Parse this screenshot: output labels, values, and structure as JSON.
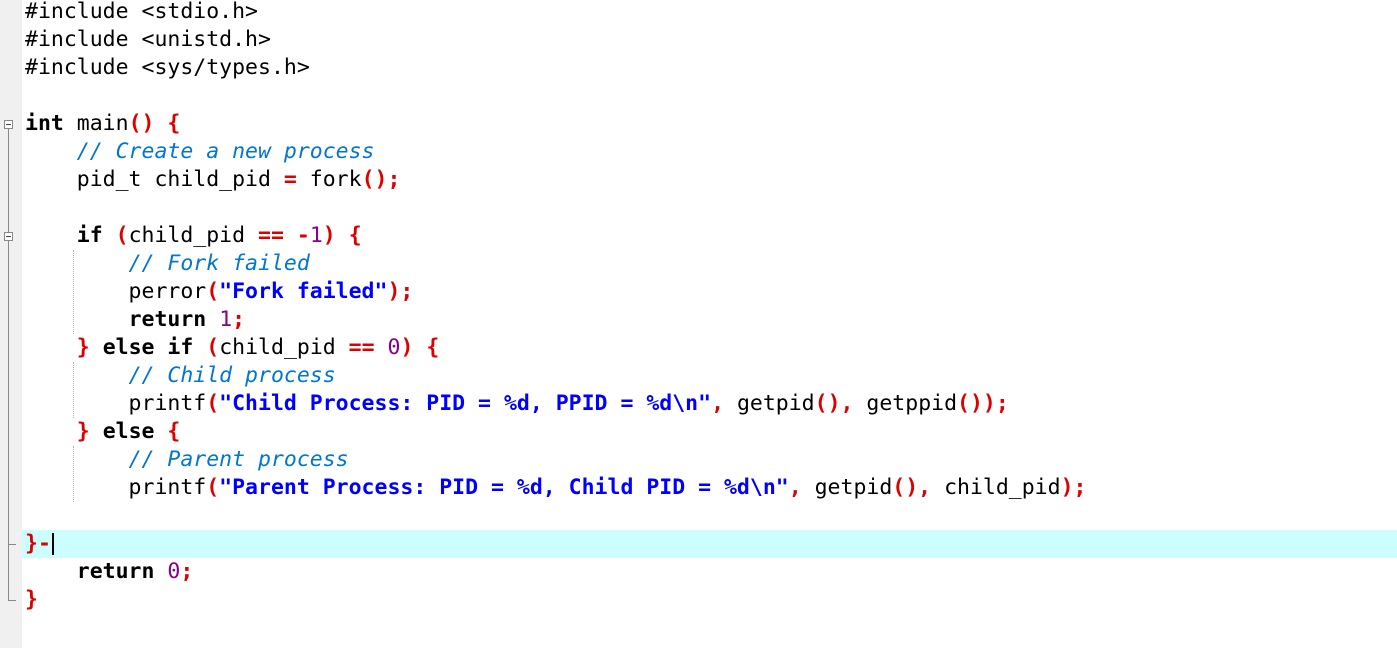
{
  "editor": {
    "lines": [
      [
        {
          "t": "#include <stdio.h>",
          "c": ""
        }
      ],
      [
        {
          "t": "#include <unistd.h>",
          "c": ""
        }
      ],
      [
        {
          "t": "#include <sys/types.h>",
          "c": ""
        }
      ],
      [],
      [
        {
          "t": "int",
          "c": "kw"
        },
        {
          "t": " main",
          "c": ""
        },
        {
          "t": "()",
          "c": "op"
        },
        {
          "t": " ",
          "c": ""
        },
        {
          "t": "{",
          "c": "op"
        }
      ],
      [
        {
          "t": "    ",
          "c": ""
        },
        {
          "t": "// Create a new process",
          "c": "cmt"
        }
      ],
      [
        {
          "t": "    pid_t child_pid ",
          "c": ""
        },
        {
          "t": "=",
          "c": "op"
        },
        {
          "t": " fork",
          "c": ""
        },
        {
          "t": "();",
          "c": "op"
        }
      ],
      [],
      [
        {
          "t": "    ",
          "c": ""
        },
        {
          "t": "if",
          "c": "kw"
        },
        {
          "t": " ",
          "c": ""
        },
        {
          "t": "(",
          "c": "op"
        },
        {
          "t": "child_pid ",
          "c": ""
        },
        {
          "t": "==",
          "c": "op"
        },
        {
          "t": " ",
          "c": ""
        },
        {
          "t": "-",
          "c": "op"
        },
        {
          "t": "1",
          "c": "num"
        },
        {
          "t": ")",
          "c": "op"
        },
        {
          "t": " ",
          "c": ""
        },
        {
          "t": "{",
          "c": "op"
        }
      ],
      [
        {
          "t": "        ",
          "c": ""
        },
        {
          "t": "// Fork failed",
          "c": "cmt"
        }
      ],
      [
        {
          "t": "        perror",
          "c": ""
        },
        {
          "t": "(",
          "c": "op"
        },
        {
          "t": "\"Fork failed\"",
          "c": "str"
        },
        {
          "t": ");",
          "c": "op"
        }
      ],
      [
        {
          "t": "        ",
          "c": ""
        },
        {
          "t": "return",
          "c": "kw"
        },
        {
          "t": " ",
          "c": ""
        },
        {
          "t": "1",
          "c": "num"
        },
        {
          "t": ";",
          "c": "op"
        }
      ],
      [
        {
          "t": "    ",
          "c": ""
        },
        {
          "t": "}",
          "c": "op"
        },
        {
          "t": " ",
          "c": ""
        },
        {
          "t": "else",
          "c": "kw"
        },
        {
          "t": " ",
          "c": ""
        },
        {
          "t": "if",
          "c": "kw"
        },
        {
          "t": " ",
          "c": ""
        },
        {
          "t": "(",
          "c": "op"
        },
        {
          "t": "child_pid ",
          "c": ""
        },
        {
          "t": "==",
          "c": "op"
        },
        {
          "t": " ",
          "c": ""
        },
        {
          "t": "0",
          "c": "num"
        },
        {
          "t": ")",
          "c": "op"
        },
        {
          "t": " ",
          "c": ""
        },
        {
          "t": "{",
          "c": "op"
        }
      ],
      [
        {
          "t": "        ",
          "c": ""
        },
        {
          "t": "// Child process",
          "c": "cmt"
        }
      ],
      [
        {
          "t": "        printf",
          "c": ""
        },
        {
          "t": "(",
          "c": "op"
        },
        {
          "t": "\"Child Process: PID = %d, PPID = %d\\n\"",
          "c": "str"
        },
        {
          "t": ",",
          "c": "op"
        },
        {
          "t": " getpid",
          "c": ""
        },
        {
          "t": "(),",
          "c": "op"
        },
        {
          "t": " getppid",
          "c": ""
        },
        {
          "t": "());",
          "c": "op"
        }
      ],
      [
        {
          "t": "    ",
          "c": ""
        },
        {
          "t": "}",
          "c": "op"
        },
        {
          "t": " ",
          "c": ""
        },
        {
          "t": "else",
          "c": "kw"
        },
        {
          "t": " ",
          "c": ""
        },
        {
          "t": "{",
          "c": "op"
        }
      ],
      [
        {
          "t": "        ",
          "c": ""
        },
        {
          "t": "// Parent process",
          "c": "cmt"
        }
      ],
      [
        {
          "t": "        printf",
          "c": ""
        },
        {
          "t": "(",
          "c": "op"
        },
        {
          "t": "\"Parent Process: PID = %d, Child PID = %d\\n\"",
          "c": "str"
        },
        {
          "t": ",",
          "c": "op"
        },
        {
          "t": " getpid",
          "c": ""
        },
        {
          "t": "(),",
          "c": "op"
        },
        {
          "t": " child_pid",
          "c": ""
        },
        {
          "t": ");",
          "c": "op"
        }
      ],
      [],
      [
        {
          "t": "}-",
          "c": "op"
        }
      ],
      [
        {
          "t": "    ",
          "c": ""
        },
        {
          "t": "return",
          "c": "kw"
        },
        {
          "t": " ",
          "c": ""
        },
        {
          "t": "0",
          "c": "num"
        },
        {
          "t": ";",
          "c": "op"
        }
      ],
      [
        {
          "t": "}",
          "c": "op"
        }
      ]
    ],
    "current_line": 19,
    "fold_markers": [
      4,
      8
    ]
  }
}
